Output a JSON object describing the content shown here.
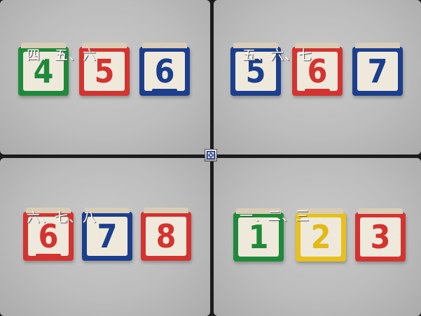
{
  "panels": [
    {
      "caption": "四、五、六",
      "digits": [
        "4",
        "5",
        "6"
      ],
      "colors": [
        "#1f8a3a",
        "#d4332f",
        "#1b3f8e"
      ]
    },
    {
      "caption": "五、六、七",
      "digits": [
        "5",
        "6",
        "7"
      ],
      "colors": [
        "#1b3f8e",
        "#d4332f",
        "#1b3f8e"
      ]
    },
    {
      "caption": "六、七、八",
      "digits": [
        "6",
        "7",
        "8"
      ],
      "colors": [
        "#d4332f",
        "#1b3f8e",
        "#d4332f"
      ]
    },
    {
      "caption": "一、二、三",
      "digits": [
        "1",
        "2",
        "3"
      ],
      "colors": [
        "#1f8a3a",
        "#e8c01b",
        "#d4332f"
      ]
    }
  ],
  "center_icon": "expand-icon"
}
